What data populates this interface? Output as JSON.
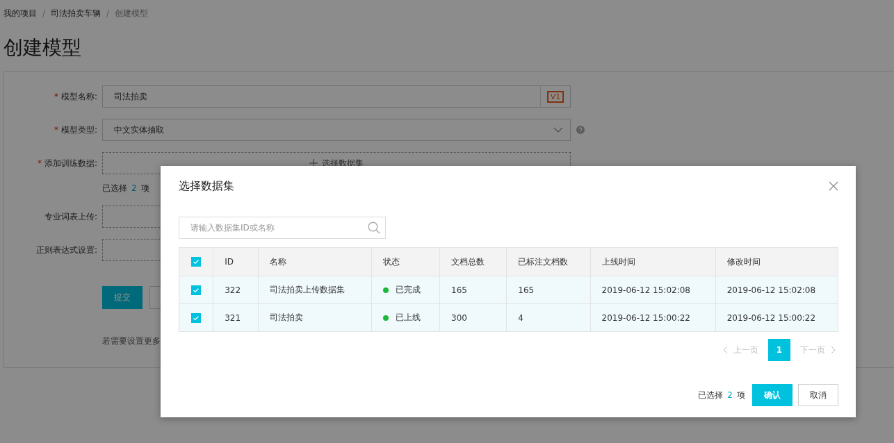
{
  "breadcrumb": [
    {
      "label": "我的项目",
      "current": false
    },
    {
      "label": "司法拍卖车辆",
      "current": false
    },
    {
      "label": "创建模型",
      "current": true
    }
  ],
  "breadcrumb_separator": "/",
  "title": "创建模型",
  "form": {
    "name": {
      "label": "模型名称:",
      "required_mark": "*",
      "value": "司法拍卖",
      "version": "V1"
    },
    "type": {
      "label": "模型类型:",
      "required_mark": "*",
      "value": "中文实体抽取"
    },
    "training_data": {
      "label": "添加训练数据:",
      "required_mark": "*",
      "button": "选择数据集",
      "selected_prefix": "已选择",
      "selected_count": "2",
      "selected_suffix": "项"
    },
    "vocabulary": {
      "label": "专业词表上传:"
    },
    "regex": {
      "label": "正则表达式设置:"
    },
    "submit": "提交",
    "hint": "若需要设置更多"
  },
  "modal": {
    "title": "选择数据集",
    "search": {
      "placeholder": "请输入数据集ID或名称"
    },
    "table": {
      "all_selected": true,
      "columns": [
        "ID",
        "名称",
        "状态",
        "文档总数",
        "已标注文档数",
        "上线时间",
        "修改时间"
      ],
      "rows": [
        {
          "selected": true,
          "id": "322",
          "name": "司法拍卖上传数据集",
          "status": "已完成",
          "color": "#1db93d",
          "total": "165",
          "labeled": "165",
          "online": "2019-06-12 15:02:08",
          "modified": "2019-06-12 15:02:08"
        },
        {
          "selected": true,
          "id": "321",
          "name": "司法拍卖",
          "status": "已上线",
          "color": "#1db93d",
          "total": "300",
          "labeled": "4",
          "online": "2019-06-12 15:00:22",
          "modified": "2019-06-12 15:00:22"
        }
      ]
    },
    "pagination": {
      "prev": "上一页",
      "next": "下一页",
      "prev_disabled": true,
      "next_disabled": true,
      "pages": [
        {
          "label": "1",
          "selected": true
        }
      ]
    },
    "footer": {
      "selected_prefix": "已选择",
      "selected_count": "2",
      "selected_suffix": "项",
      "confirm": "确认",
      "cancel": "取消"
    }
  }
}
